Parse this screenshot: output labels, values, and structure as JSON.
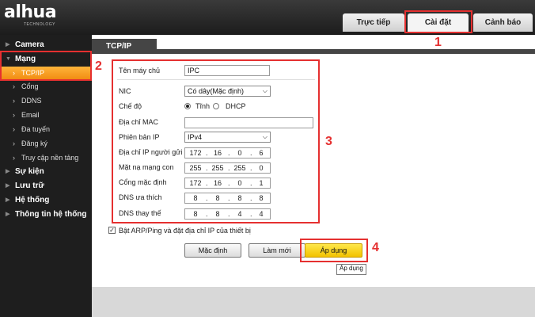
{
  "brand": {
    "logo": "alhua",
    "tagline": "TECHNOLOGY"
  },
  "top_tabs": [
    {
      "label": "Trực tiếp"
    },
    {
      "label": "Cài đặt"
    },
    {
      "label": "Cảnh báo"
    }
  ],
  "sidebar": {
    "items": [
      {
        "label": "Camera"
      },
      {
        "label": "Mạng"
      },
      {
        "label": "Sự kiện"
      },
      {
        "label": "Lưu trữ"
      },
      {
        "label": "Hệ thống"
      },
      {
        "label": "Thông tin hệ thống"
      }
    ],
    "sub_items": [
      {
        "label": "TCP/IP"
      },
      {
        "label": "Cổng"
      },
      {
        "label": "DDNS"
      },
      {
        "label": "Email"
      },
      {
        "label": "Đa tuyến"
      },
      {
        "label": "Đăng ký"
      },
      {
        "label": "Truy cập nền tảng"
      }
    ]
  },
  "content_tab": "TCP/IP",
  "form": {
    "hostname_label": "Tên máy chủ",
    "hostname_value": "IPC",
    "nic_label": "NIC",
    "nic_value": "Có dây(Mặc định)",
    "mode_label": "Chế độ",
    "mode_static": "Tĩnh",
    "mode_dhcp": "DHCP",
    "mac_label": "Địa chỉ MAC",
    "mac_value": "",
    "ipver_label": "Phiên bản IP",
    "ipver_value": "IPv4",
    "ip_label": "Địa chỉ IP người gửi",
    "ip": [
      "172",
      "16",
      "0",
      "6"
    ],
    "mask_label": "Mặt nạ mạng con",
    "mask": [
      "255",
      "255",
      "255",
      "0"
    ],
    "gw_label": "Cổng mặc định",
    "gw": [
      "172",
      "16",
      "0",
      "1"
    ],
    "dns1_label": "DNS ưa thích",
    "dns1": [
      "8",
      "8",
      "8",
      "8"
    ],
    "dns2_label": "DNS thay thế",
    "dns2": [
      "8",
      "8",
      "4",
      "4"
    ],
    "arp_label": "Bật ARP/Ping và đặt địa chỉ IP của thiết bị"
  },
  "buttons": {
    "default": "Mặc định",
    "refresh": "Làm mới",
    "apply": "Áp dụng",
    "tooltip": "Áp dụng"
  },
  "annotations": [
    "1",
    "2",
    "3",
    "4"
  ],
  "colors": {
    "highlight": "#e53030",
    "active_nav": "#f08a10",
    "apply_button": "#f2c200"
  }
}
